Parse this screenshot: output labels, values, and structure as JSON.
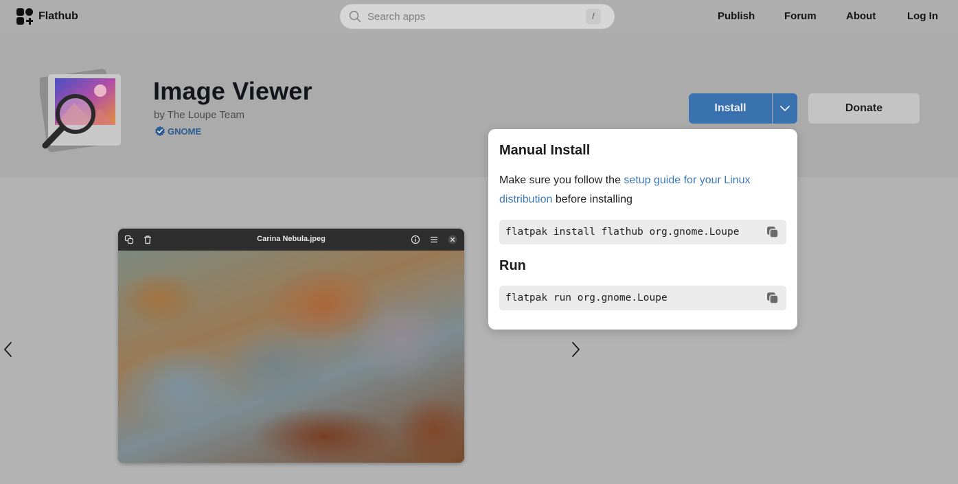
{
  "nav": {
    "brand": "Flathub",
    "search_placeholder": "Search apps",
    "search_shortcut": "/",
    "links": [
      "Publish",
      "Forum",
      "About",
      "Log In"
    ]
  },
  "app": {
    "title": "Image Viewer",
    "developer": "by The Loupe Team",
    "verified_label": "GNOME",
    "install_label": "Install",
    "donate_label": "Donate"
  },
  "screenshot": {
    "window_title": "Carina Nebula.jpeg"
  },
  "popover": {
    "heading_install": "Manual Install",
    "intro_before": "Make sure you follow the ",
    "intro_link": "setup guide for your Linux distribution",
    "intro_after": " before installing",
    "install_command": "flatpak install flathub org.gnome.Loupe",
    "heading_run": "Run",
    "run_command": "flatpak run org.gnome.Loupe"
  },
  "colors": {
    "accent": "#3a72b0",
    "link": "#3b7ab8",
    "verified": "#2d5c92"
  },
  "icons": [
    "flathub-logo-icon",
    "search-icon",
    "verified-check-icon",
    "chevron-down-icon",
    "chevron-left-icon",
    "chevron-right-icon",
    "copy-icon",
    "duplicate-icon",
    "trash-icon",
    "info-icon",
    "menu-icon",
    "close-icon",
    "app-image-viewer-icon"
  ]
}
